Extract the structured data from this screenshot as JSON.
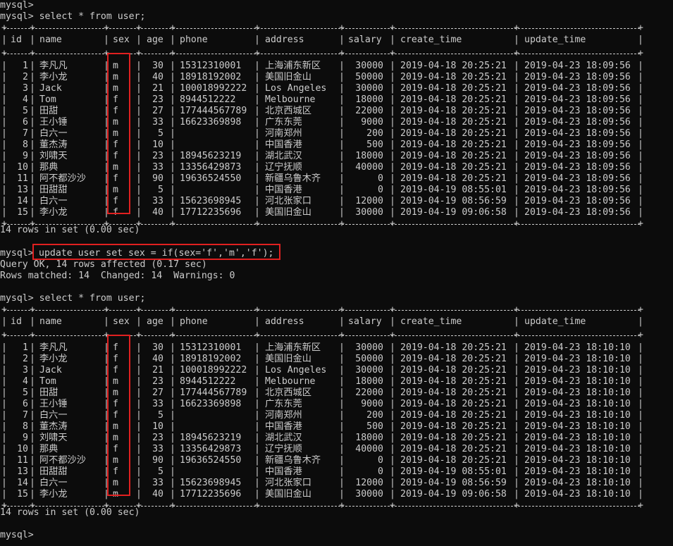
{
  "terminal": {
    "prompt_top": "mysql>",
    "cmd1": "mysql> select * from user;",
    "rows_msg_1": "14 rows in set (0.00 sec)",
    "update_prompt": "mysql>",
    "update_cmd": "update user set sex = if(sex='f','m','f');",
    "query_ok": "Query OK, 14 rows affected (0.17 sec)",
    "rows_matched": "Rows matched: 14  Changed: 14  Warnings: 0",
    "cmd2": "mysql> select * from user;",
    "rows_msg_2": "14 rows in set (0.00 sec)",
    "final_prompt": "mysql>"
  },
  "columns": [
    "id",
    "name",
    "sex",
    "age",
    "phone",
    "address",
    "salary",
    "create_time",
    "update_time"
  ],
  "table1": [
    [
      "1",
      "李凡凡",
      "m",
      "30",
      "15312310001",
      "上海浦东新区",
      "30000",
      "2019-04-18 20:25:21",
      "2019-04-23 18:09:56"
    ],
    [
      "2",
      "李小龙",
      "m",
      "40",
      "18918192002",
      "美国旧金山",
      "50000",
      "2019-04-18 20:25:21",
      "2019-04-23 18:09:56"
    ],
    [
      "3",
      "Jack",
      "m",
      "21",
      "100018992222",
      "Los Angeles",
      "30000",
      "2019-04-18 20:25:21",
      "2019-04-23 18:09:56"
    ],
    [
      "4",
      "Tom",
      "f",
      "23",
      "8944512222",
      "Melbourne",
      "18000",
      "2019-04-18 20:25:21",
      "2019-04-23 18:09:56"
    ],
    [
      "5",
      "田甜",
      "f",
      "27",
      "177444567789",
      "北京西城区",
      "22000",
      "2019-04-18 20:25:21",
      "2019-04-23 18:09:56"
    ],
    [
      "6",
      "王小锤",
      "m",
      "33",
      "16623369898",
      "广东东莞",
      "9000",
      "2019-04-18 20:25:21",
      "2019-04-23 18:09:56"
    ],
    [
      "7",
      "白六一",
      "m",
      "5",
      "",
      "河南郑州",
      "200",
      "2019-04-18 20:25:21",
      "2019-04-23 18:09:56"
    ],
    [
      "8",
      "董杰涛",
      "f",
      "10",
      "",
      "中国香港",
      "500",
      "2019-04-18 20:25:21",
      "2019-04-23 18:09:56"
    ],
    [
      "9",
      "刘啸天",
      "f",
      "23",
      "18945623219",
      "湖北武汉",
      "18000",
      "2019-04-18 20:25:21",
      "2019-04-23 18:09:56"
    ],
    [
      "10",
      "那典",
      "m",
      "33",
      "13356429873",
      "辽宁抚顺",
      "40000",
      "2019-04-18 20:25:21",
      "2019-04-23 18:09:56"
    ],
    [
      "11",
      "阿不都沙沙",
      "f",
      "90",
      "19636524550",
      "新疆乌鲁木齐",
      "0",
      "2019-04-18 20:25:21",
      "2019-04-23 18:09:56"
    ],
    [
      "13",
      "田甜甜",
      "m",
      "5",
      "",
      "中国香港",
      "0",
      "2019-04-19 08:55:01",
      "2019-04-23 18:09:56"
    ],
    [
      "14",
      "白六一",
      "f",
      "33",
      "15623698945",
      "河北张家口",
      "12000",
      "2019-04-19 08:56:59",
      "2019-04-23 18:09:56"
    ],
    [
      "15",
      "李小龙",
      "f",
      "40",
      "17712235696",
      "美国旧金山",
      "30000",
      "2019-04-19 09:06:58",
      "2019-04-23 18:09:56"
    ]
  ],
  "table2": [
    [
      "1",
      "李凡凡",
      "f",
      "30",
      "15312310001",
      "上海浦东新区",
      "30000",
      "2019-04-18 20:25:21",
      "2019-04-23 18:10:10"
    ],
    [
      "2",
      "李小龙",
      "f",
      "40",
      "18918192002",
      "美国旧金山",
      "50000",
      "2019-04-18 20:25:21",
      "2019-04-23 18:10:10"
    ],
    [
      "3",
      "Jack",
      "f",
      "21",
      "100018992222",
      "Los Angeles",
      "30000",
      "2019-04-18 20:25:21",
      "2019-04-23 18:10:10"
    ],
    [
      "4",
      "Tom",
      "m",
      "23",
      "8944512222",
      "Melbourne",
      "18000",
      "2019-04-18 20:25:21",
      "2019-04-23 18:10:10"
    ],
    [
      "5",
      "田甜",
      "m",
      "27",
      "177444567789",
      "北京西城区",
      "22000",
      "2019-04-18 20:25:21",
      "2019-04-23 18:10:10"
    ],
    [
      "6",
      "王小锤",
      "f",
      "33",
      "16623369898",
      "广东东莞",
      "9000",
      "2019-04-18 20:25:21",
      "2019-04-23 18:10:10"
    ],
    [
      "7",
      "白六一",
      "f",
      "5",
      "",
      "河南郑州",
      "200",
      "2019-04-18 20:25:21",
      "2019-04-23 18:10:10"
    ],
    [
      "8",
      "董杰涛",
      "m",
      "10",
      "",
      "中国香港",
      "500",
      "2019-04-18 20:25:21",
      "2019-04-23 18:10:10"
    ],
    [
      "9",
      "刘啸天",
      "m",
      "23",
      "18945623219",
      "湖北武汉",
      "18000",
      "2019-04-18 20:25:21",
      "2019-04-23 18:10:10"
    ],
    [
      "10",
      "那典",
      "f",
      "33",
      "13356429873",
      "辽宁抚顺",
      "40000",
      "2019-04-18 20:25:21",
      "2019-04-23 18:10:10"
    ],
    [
      "11",
      "阿不都沙沙",
      "m",
      "90",
      "19636524550",
      "新疆乌鲁木齐",
      "0",
      "2019-04-18 20:25:21",
      "2019-04-23 18:10:10"
    ],
    [
      "13",
      "田甜甜",
      "f",
      "5",
      "",
      "中国香港",
      "0",
      "2019-04-19 08:55:01",
      "2019-04-23 18:10:10"
    ],
    [
      "14",
      "白六一",
      "m",
      "33",
      "15623698945",
      "河北张家口",
      "12000",
      "2019-04-19 08:56:59",
      "2019-04-23 18:10:10"
    ],
    [
      "15",
      "李小龙",
      "m",
      "40",
      "17712235696",
      "美国旧金山",
      "30000",
      "2019-04-19 09:06:58",
      "2019-04-23 18:10:10"
    ]
  ],
  "colors": {
    "background": "#0c0c0c",
    "text": "#cccccc",
    "highlight": "#e02020"
  }
}
